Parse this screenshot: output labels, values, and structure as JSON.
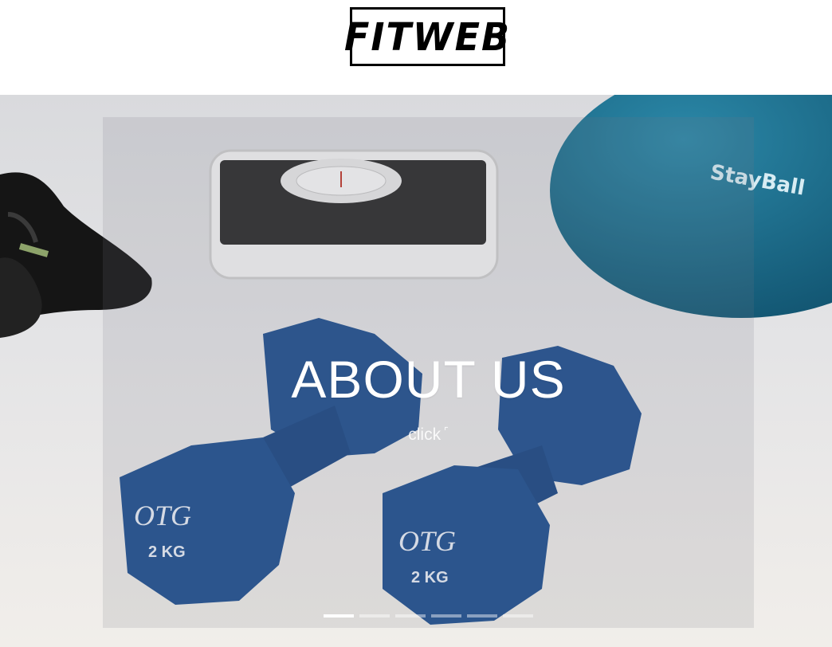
{
  "header": {
    "logo_text": "FITWEB"
  },
  "hero": {
    "title": "ABOUT US",
    "cta_label": "click",
    "cta_arrow_icon": "corner-arrow-icon",
    "slides": [
      {
        "active": true
      },
      {
        "active": false
      },
      {
        "active": false
      },
      {
        "active": false
      },
      {
        "active": false
      },
      {
        "active": false
      }
    ],
    "image": {
      "ball_brand": "StayBall",
      "dumbbell_brand": "OTG",
      "dumbbell_weight": "2 KG"
    }
  },
  "colors": {
    "dumbbell": "#1e4f8f",
    "ball": "#1f6f8f",
    "background": "#eceae6"
  }
}
